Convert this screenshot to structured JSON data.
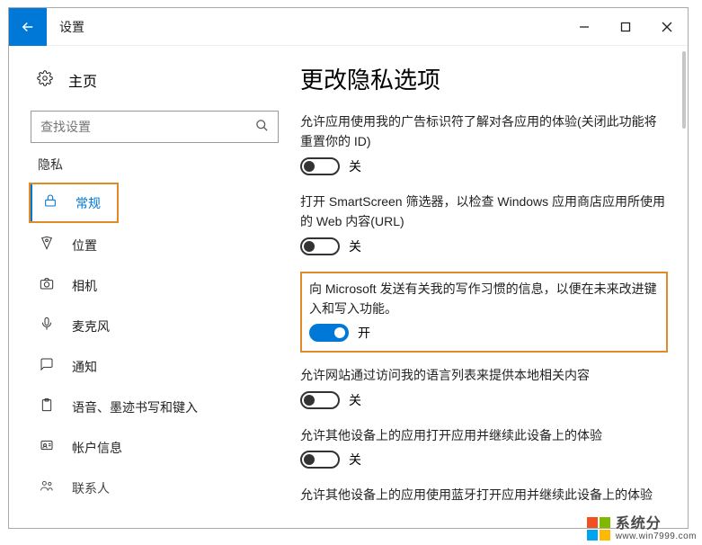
{
  "window": {
    "title": "设置"
  },
  "sidebar": {
    "home_label": "主页",
    "search_placeholder": "查找设置",
    "group_label": "隐私",
    "items": [
      {
        "label": "常规"
      },
      {
        "label": "位置"
      },
      {
        "label": "相机"
      },
      {
        "label": "麦克风"
      },
      {
        "label": "通知"
      },
      {
        "label": "语音、墨迹书写和键入"
      },
      {
        "label": "帐户信息"
      },
      {
        "label": "联系人"
      }
    ]
  },
  "main": {
    "heading": "更改隐私选项",
    "settings": [
      {
        "desc": "允许应用使用我的广告标识符了解对各应用的体验(关闭此功能将重置你的 ID)",
        "state_label": "关",
        "on": false
      },
      {
        "desc": "打开 SmartScreen 筛选器，以检查 Windows 应用商店应用所使用的 Web 内容(URL)",
        "state_label": "关",
        "on": false
      },
      {
        "desc": "向 Microsoft 发送有关我的写作习惯的信息，以便在未来改进键入和写入功能。",
        "state_label": "开",
        "on": true,
        "highlighted": true
      },
      {
        "desc": "允许网站通过访问我的语言列表来提供本地相关内容",
        "state_label": "关",
        "on": false
      },
      {
        "desc": "允许其他设备上的应用打开应用并继续此设备上的体验",
        "state_label": "关",
        "on": false
      },
      {
        "desc": "允许其他设备上的应用使用蓝牙打开应用并继续此设备上的体验",
        "state_label": "",
        "on": false,
        "partial": true
      }
    ]
  },
  "watermark": {
    "name": "系统分",
    "url": "www.win7999.com"
  }
}
